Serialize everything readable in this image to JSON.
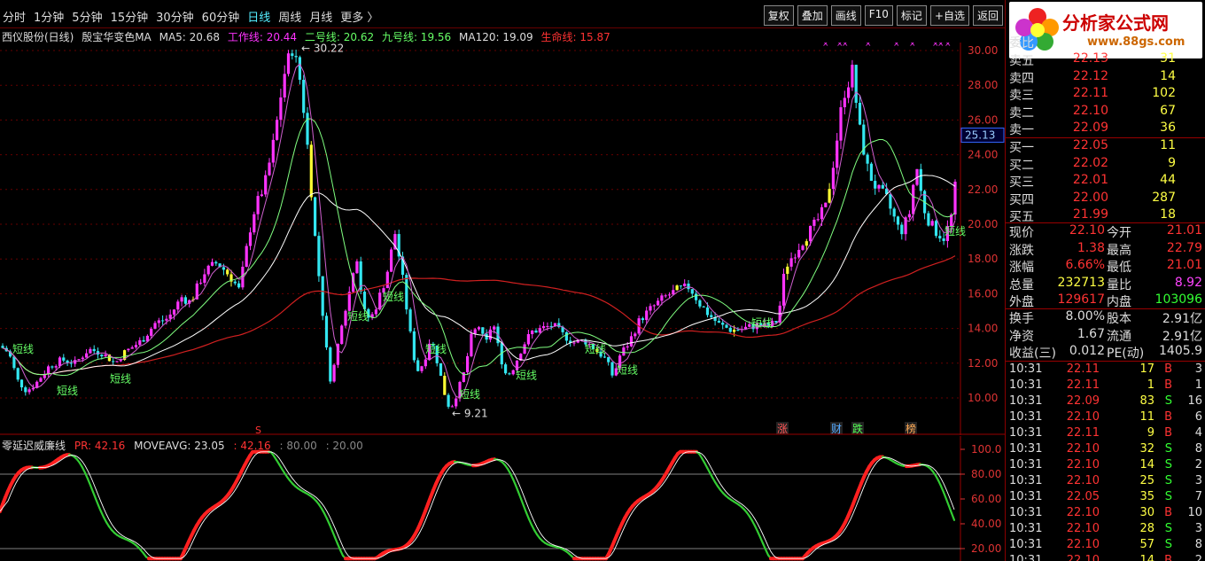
{
  "period_tabs": [
    "分时",
    "1分钟",
    "5分钟",
    "15分钟",
    "30分钟",
    "60分钟",
    "日线",
    "周线",
    "月线",
    "更多 〉"
  ],
  "active_period": "日线",
  "tool_buttons": [
    "复权",
    "叠加",
    "画线",
    "F10",
    "标记",
    "+自选",
    "返回"
  ],
  "title_line": {
    "stock": "西仪股份(日线)",
    "indicator": "殷宝华变色MA",
    "ma5": "MA5: 20.68",
    "work": "工作线: 20.44",
    "two": "二号线: 20.62",
    "nine": "九号线: 19.56",
    "ma120": "MA120: 19.09",
    "life": "生命线: 15.87"
  },
  "price_axis": [
    "30.00",
    "28.00",
    "26.00",
    "24.00",
    "22.00",
    "20.00",
    "18.00",
    "16.00",
    "14.00",
    "12.00",
    "10.00"
  ],
  "current_price_tag": "25.13",
  "high_label": "30.22",
  "low_label": "9.21",
  "short_line_label": "短线",
  "event_markers": [
    "涨",
    "财",
    "跌",
    "榜"
  ],
  "s_marker": "S",
  "ind_title": {
    "name": "零延迟威廉线",
    "pr": "PR: 42.16",
    "moveavg": "MOVEAVG: 23.05",
    "val": ": 42.16",
    "v80": ": 80.00",
    "v20": ": 20.00"
  },
  "ind_axis": [
    "100.0",
    "80.00",
    "60.00",
    "40.00",
    "20.00"
  ],
  "logo": {
    "brand": "分析家公式网",
    "url": "www.88gs.com"
  },
  "order_book_header": "委比",
  "sell": [
    {
      "label": "卖五",
      "price": "22.13",
      "vol": "31"
    },
    {
      "label": "卖四",
      "price": "22.12",
      "vol": "14"
    },
    {
      "label": "卖三",
      "price": "22.11",
      "vol": "102"
    },
    {
      "label": "卖二",
      "price": "22.10",
      "vol": "67"
    },
    {
      "label": "卖一",
      "price": "22.09",
      "vol": "36"
    }
  ],
  "buy": [
    {
      "label": "买一",
      "price": "22.05",
      "vol": "11"
    },
    {
      "label": "买二",
      "price": "22.02",
      "vol": "9"
    },
    {
      "label": "买三",
      "price": "22.01",
      "vol": "44"
    },
    {
      "label": "买四",
      "price": "22.00",
      "vol": "287"
    },
    {
      "label": "买五",
      "price": "21.99",
      "vol": "18"
    }
  ],
  "info": [
    {
      "l1": "现价",
      "v1": "22.10",
      "l2": "今开",
      "v2": "21.01",
      "c1": "#f33",
      "c2": "#f33"
    },
    {
      "l1": "涨跌",
      "v1": "1.38",
      "l2": "最高",
      "v2": "22.79",
      "c1": "#f33",
      "c2": "#f33"
    },
    {
      "l1": "涨幅",
      "v1": "6.66%",
      "l2": "最低",
      "v2": "21.01",
      "c1": "#f33",
      "c2": "#f33"
    },
    {
      "l1": "总量",
      "v1": "232713",
      "l2": "量比",
      "v2": "8.92",
      "c1": "#ff4",
      "c2": "#f4f"
    },
    {
      "l1": "外盘",
      "v1": "129617",
      "l2": "内盘",
      "v2": "103096",
      "c1": "#f33",
      "c2": "#3f3"
    }
  ],
  "info2": [
    {
      "l1": "换手",
      "v1": "8.00%",
      "l2": "股本",
      "v2": "2.91亿"
    },
    {
      "l1": "净资",
      "v1": "1.67",
      "l2": "流通",
      "v2": "2.91亿"
    },
    {
      "l1": "收益(三)",
      "v1": "0.012",
      "l2": "PE(动)",
      "v2": "1405.9"
    }
  ],
  "trades": [
    {
      "t": "10:31",
      "p": "22.11",
      "v": "17",
      "d": "B",
      "n": "3"
    },
    {
      "t": "10:31",
      "p": "22.11",
      "v": "1",
      "d": "B",
      "n": "1"
    },
    {
      "t": "10:31",
      "p": "22.09",
      "v": "83",
      "d": "S",
      "n": "16"
    },
    {
      "t": "10:31",
      "p": "22.10",
      "v": "11",
      "d": "B",
      "n": "6"
    },
    {
      "t": "10:31",
      "p": "22.11",
      "v": "9",
      "d": "B",
      "n": "4"
    },
    {
      "t": "10:31",
      "p": "22.10",
      "v": "32",
      "d": "S",
      "n": "8"
    },
    {
      "t": "10:31",
      "p": "22.10",
      "v": "14",
      "d": "S",
      "n": "2"
    },
    {
      "t": "10:31",
      "p": "22.10",
      "v": "25",
      "d": "S",
      "n": "3"
    },
    {
      "t": "10:31",
      "p": "22.05",
      "v": "35",
      "d": "S",
      "n": "7"
    },
    {
      "t": "10:31",
      "p": "22.10",
      "v": "30",
      "d": "B",
      "n": "10"
    },
    {
      "t": "10:31",
      "p": "22.10",
      "v": "28",
      "d": "S",
      "n": "3"
    },
    {
      "t": "10:31",
      "p": "22.10",
      "v": "57",
      "d": "S",
      "n": "8"
    },
    {
      "t": "10:31",
      "p": "22.10",
      "v": "14",
      "d": "B",
      "n": "2"
    }
  ],
  "colors": {
    "up": "#ff33ff",
    "down": "#33e6f0",
    "yellow": "#ffff33",
    "ma_red": "#d02020",
    "ma_white": "#ffffff",
    "ma_green": "#80ff80",
    "ind_red": "#ff2020",
    "ind_green": "#33cc33"
  }
}
